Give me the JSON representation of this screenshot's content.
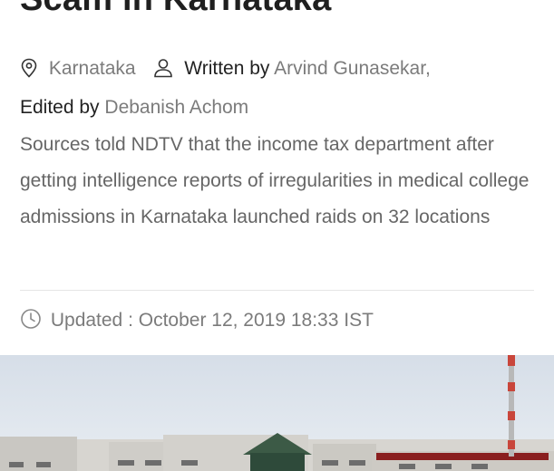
{
  "article": {
    "headline": "Scam in Karnataka",
    "location": "Karnataka",
    "written_by_label": "Written by",
    "author": "Arvind Gunasekar,",
    "edited_by_label": "Edited by",
    "editor": "Debanish Achom",
    "summary": "Sources told NDTV that the income tax department after getting intelligence reports of irregularities in medical college admissions in Karnataka launched raids on 32 locations",
    "updated": "Updated : October 12, 2019 18:33 IST"
  },
  "icons": {
    "location": "map-pin-icon",
    "author": "person-icon",
    "updated": "clock-icon"
  },
  "colors": {
    "text": "#222222",
    "muted": "#7b7b7b",
    "summary": "#666666"
  }
}
